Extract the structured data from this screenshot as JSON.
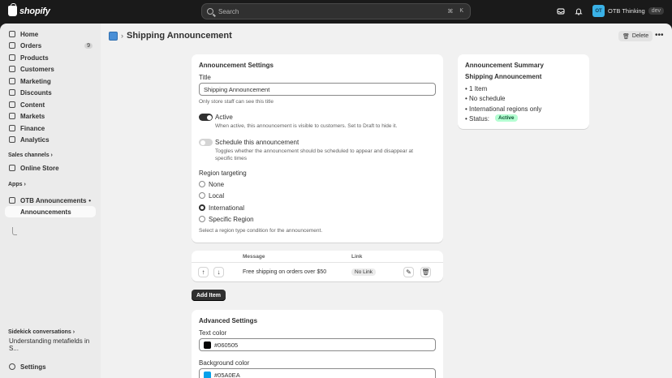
{
  "topbar": {
    "logo_text": "shopify",
    "search_placeholder": "Search",
    "shortcut_cmd": "⌘",
    "shortcut_key": "K",
    "store_initials": "OT",
    "store_name": "OTB Thinking",
    "dev_badge": "dev"
  },
  "sidebar": {
    "items": [
      {
        "label": "Home"
      },
      {
        "label": "Orders",
        "badge": "9"
      },
      {
        "label": "Products"
      },
      {
        "label": "Customers"
      },
      {
        "label": "Marketing"
      },
      {
        "label": "Discounts"
      },
      {
        "label": "Content"
      },
      {
        "label": "Markets"
      },
      {
        "label": "Finance"
      },
      {
        "label": "Analytics"
      }
    ],
    "sales_channels_label": "Sales channels",
    "online_store_label": "Online Store",
    "apps_label": "Apps",
    "app_name": "OTB Announcements",
    "app_sub_item": "Announcements",
    "sidekick_label": "Sidekick conversations",
    "sidekick_item": "Understanding metafields in S...",
    "settings_label": "Settings"
  },
  "header": {
    "breadcrumb_sep": "›",
    "title": "Shipping Announcement",
    "delete_label": "Delete",
    "more_label": "•••"
  },
  "settings_card": {
    "title": "Announcement Settings",
    "title_label": "Title",
    "title_value": "Shipping Announcement",
    "title_help": "Only store staff can see this title",
    "active_label": "Active",
    "active_help": "When active, this announcement is visible to customers. Set to Draft to hide it.",
    "schedule_label": "Schedule this announcement",
    "schedule_help_1": "Toggles whether the announcement should be scheduled to appear and disappear at",
    "schedule_help_2": "specific times",
    "region_label": "Region targeting",
    "region_options": [
      "None",
      "Local",
      "International",
      "Specific Region"
    ],
    "region_selected": "International",
    "region_help": "Select a region type condition for the announcement."
  },
  "summary_card": {
    "title": "Announcement Summary",
    "name": "Shipping Announcement",
    "lines": [
      "1 Item",
      "No schedule",
      "International regions only"
    ],
    "status_label": "Status:",
    "status_value": "Active"
  },
  "items_table": {
    "col_message": "Message",
    "col_link": "Link",
    "rows": [
      {
        "message": "Free shipping on orders over $50",
        "link": "No Link"
      }
    ],
    "up_icon": "↑",
    "down_icon": "↓",
    "edit_icon": "✎",
    "delete_icon": "🗑"
  },
  "add_item_label": "Add Item",
  "advanced_card": {
    "title": "Advanced Settings",
    "text_color_label": "Text color",
    "text_color_value": "#060505",
    "bg_color_label": "Background color",
    "bg_color_value": "#05A0EA"
  },
  "colors": {
    "text_swatch": "#060505",
    "bg_swatch": "#05A0EA",
    "accent": "#303030"
  }
}
